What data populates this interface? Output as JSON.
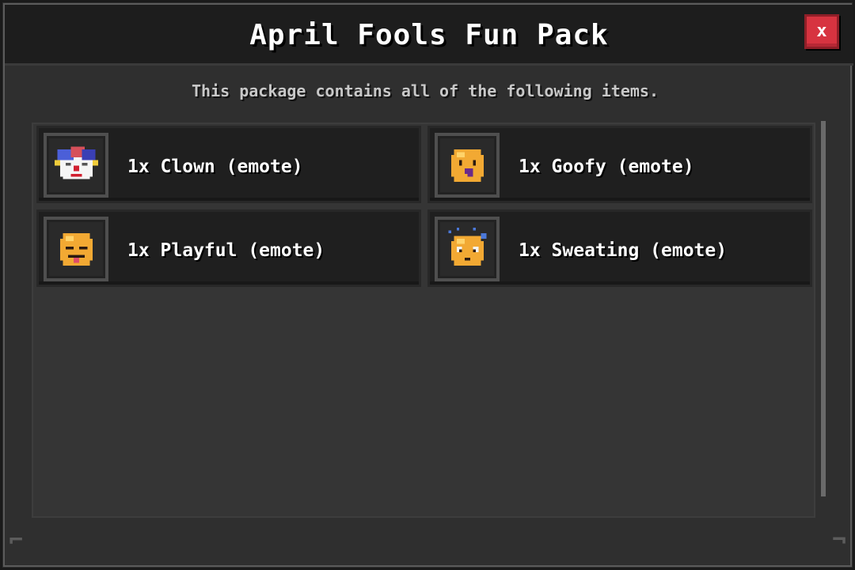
{
  "modal": {
    "title": "April Fools Fun Pack",
    "close_label": "x",
    "subtitle": "This package contains all of the following items."
  },
  "items": [
    {
      "label": "1x Clown (emote)",
      "icon": "clown-emote-icon"
    },
    {
      "label": "1x Goofy (emote)",
      "icon": "goofy-emote-icon"
    },
    {
      "label": "1x Playful (emote)",
      "icon": "playful-emote-icon"
    },
    {
      "label": "1x Sweating (emote)",
      "icon": "sweating-emote-icon"
    }
  ],
  "colors": {
    "close_button": "#d73340",
    "panel": "#2f2f2f",
    "title_bar": "#1d1d1d",
    "emote_yellow": "#f2a933"
  }
}
